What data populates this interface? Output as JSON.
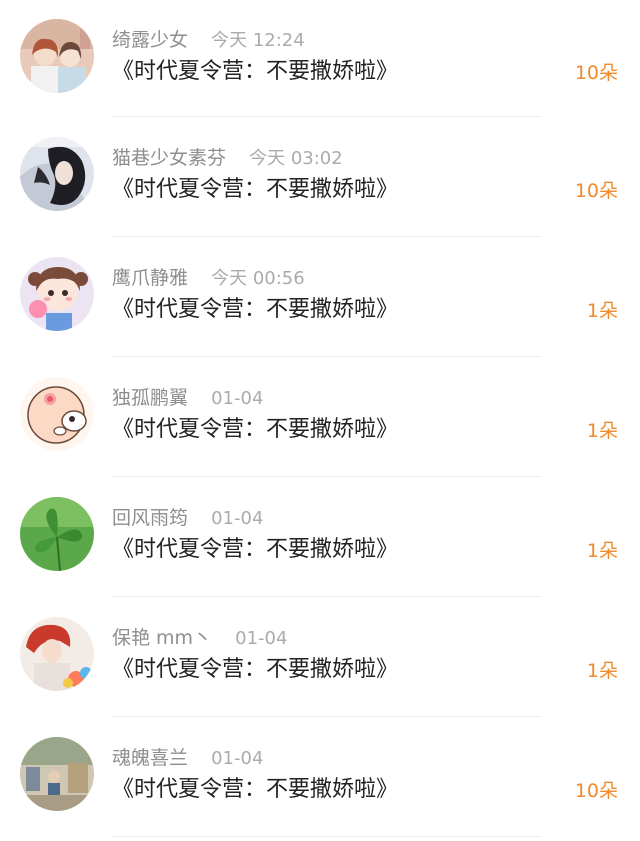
{
  "gift_records": [
    {
      "user": "绮露少女",
      "time": "今天 12:24",
      "title": "《时代夏令营：不要撒娇啦》",
      "flowers": "10朵",
      "avatar_icon": "avatar-two-girls-photo"
    },
    {
      "user": "猫巷少女素芬",
      "time": "今天 03:02",
      "title": "《时代夏令营：不要撒娇啦》",
      "flowers": "10朵",
      "avatar_icon": "avatar-girl-long-hair"
    },
    {
      "user": "鹰爪静雅",
      "time": "今天 00:56",
      "title": "《时代夏令营：不要撒娇啦》",
      "flowers": "1朵",
      "avatar_icon": "avatar-anime-girl-balloon"
    },
    {
      "user": "独孤鹏翼",
      "time": "01-04",
      "title": "《时代夏令营：不要撒娇啦》",
      "flowers": "1朵",
      "avatar_icon": "avatar-cartoon-pig"
    },
    {
      "user": "回风雨筠",
      "time": "01-04",
      "title": "《时代夏令营：不要撒娇啦》",
      "flowers": "1朵",
      "avatar_icon": "avatar-clover-leaf"
    },
    {
      "user": "保艳 mm丶",
      "time": "01-04",
      "title": "《时代夏令营：不要撒娇啦》",
      "flowers": "1朵",
      "avatar_icon": "avatar-red-hair-girl"
    },
    {
      "user": "魂魄喜兰",
      "time": "01-04",
      "title": "《时代夏令营：不要撒娇啦》",
      "flowers": "10朵",
      "avatar_icon": "avatar-street-photo"
    }
  ],
  "colors": {
    "accent_orange": "#f08a2c",
    "username_gray": "#8e8e8e",
    "time_gray": "#ababab",
    "title_black": "#222222",
    "divider": "#efefef"
  }
}
